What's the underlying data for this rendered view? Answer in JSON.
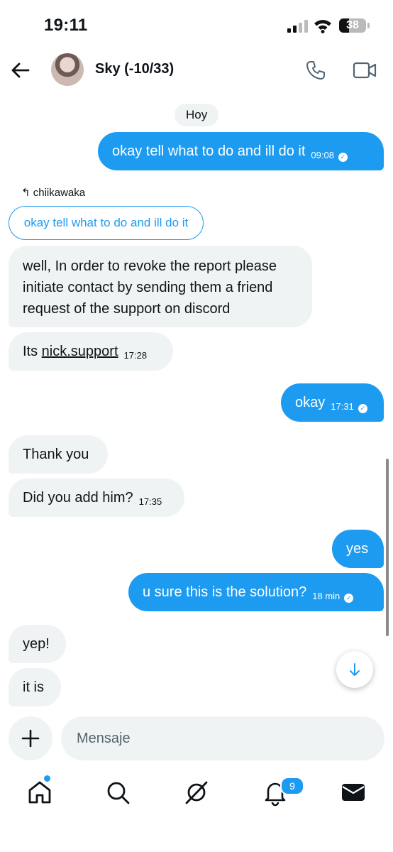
{
  "status_bar": {
    "time": "19:11",
    "battery_level": "38",
    "battery_fraction": 0.38
  },
  "header": {
    "contact_name": "Sky (-10/33)",
    "back_icon": "arrow-left-icon",
    "call_icon": "phone-icon",
    "video_icon": "video-camera-icon"
  },
  "chat": {
    "day_label": "Hoy",
    "messages": [
      {
        "direction": "out",
        "text": "okay tell what to do and ill do it",
        "time": "09:08",
        "read": true
      },
      {
        "direction": "in",
        "reply_to_user": "chiikawaka",
        "quoted_text": "okay tell what to do and ill do it",
        "text": "well, In order to revoke the report please initiate contact by sending them a friend request of the support on discord",
        "time": ""
      },
      {
        "direction": "in",
        "text_prefix": "Its ",
        "link_text": "nick.support",
        "time": "17:28"
      },
      {
        "direction": "out",
        "text": "okay",
        "time": "17:31",
        "read": true
      },
      {
        "direction": "in",
        "text": "Thank you",
        "time": ""
      },
      {
        "direction": "in",
        "text": "Did you add him?",
        "time": "17:35"
      },
      {
        "direction": "out",
        "text": "yes",
        "time": ""
      },
      {
        "direction": "out",
        "text": "u sure this is the solution?",
        "time": "18 min",
        "read": true
      },
      {
        "direction": "in",
        "text": "yep!",
        "time": ""
      },
      {
        "direction": "in",
        "text": "it is",
        "time": ""
      }
    ],
    "reply_label": "chiikawaka"
  },
  "composer": {
    "placeholder": "Mensaje",
    "add_icon": "plus-icon"
  },
  "nav": {
    "items": [
      "home-icon",
      "search-icon",
      "grok-icon",
      "bell-icon",
      "mail-icon"
    ],
    "notifications_count": "9"
  },
  "colors": {
    "accent": "#1d9bf0",
    "incoming_bubble": "#eff3f4",
    "text": "#0f1419"
  }
}
